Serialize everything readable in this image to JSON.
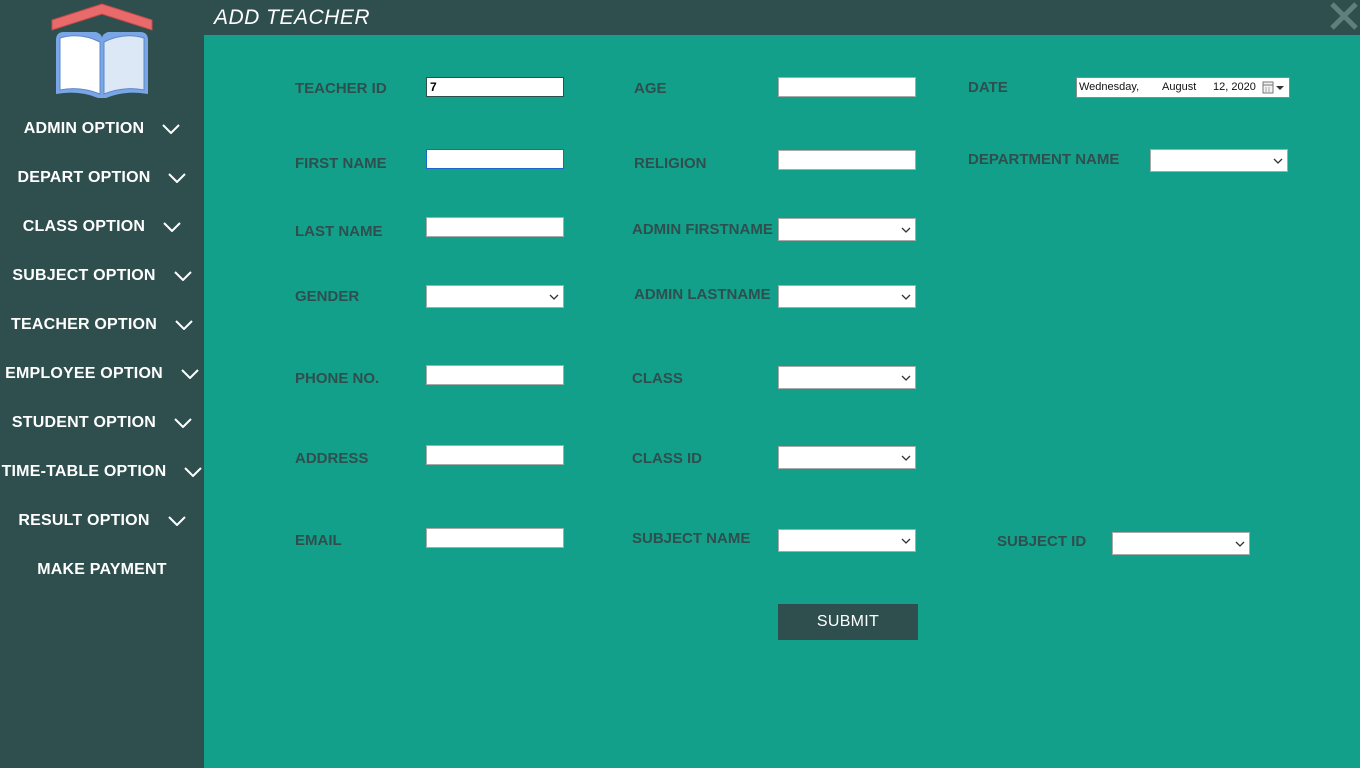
{
  "window": {
    "title": "ADD TEACHER"
  },
  "sidebar": {
    "items": [
      {
        "label": "ADMIN OPTION"
      },
      {
        "label": "DEPART OPTION"
      },
      {
        "label": "CLASS OPTION"
      },
      {
        "label": "SUBJECT OPTION"
      },
      {
        "label": "TEACHER OPTION"
      },
      {
        "label": "EMPLOYEE OPTION"
      },
      {
        "label": "STUDENT OPTION"
      },
      {
        "label": "TIME-TABLE OPTION"
      },
      {
        "label": "RESULT OPTION"
      },
      {
        "label": "MAKE PAYMENT"
      }
    ]
  },
  "form": {
    "teacher_id": {
      "label": "TEACHER ID",
      "value": "7"
    },
    "first_name": {
      "label": "FIRST NAME",
      "value": ""
    },
    "last_name": {
      "label": "LAST NAME",
      "value": ""
    },
    "gender": {
      "label": "GENDER",
      "value": ""
    },
    "phone": {
      "label": "PHONE NO.",
      "value": ""
    },
    "address": {
      "label": "ADDRESS",
      "value": ""
    },
    "email": {
      "label": "EMAIL",
      "value": ""
    },
    "age": {
      "label": "AGE",
      "value": ""
    },
    "religion": {
      "label": "RELIGION",
      "value": ""
    },
    "admin_firstname": {
      "label": "ADMIN FIRSTNAME",
      "value": ""
    },
    "admin_lastname": {
      "label": "ADMIN LASTNAME",
      "value": ""
    },
    "class": {
      "label": "CLASS",
      "value": ""
    },
    "class_id": {
      "label": "CLASS ID",
      "value": ""
    },
    "subject_name": {
      "label": "SUBJECT NAME",
      "value": ""
    },
    "subject_id": {
      "label": "SUBJECT ID",
      "value": ""
    },
    "date": {
      "label": "DATE",
      "weekday": "Wednesday,",
      "month": "August",
      "day_year": "12, 2020"
    },
    "department_name": {
      "label": "DEPARTMENT NAME",
      "value": ""
    },
    "submit_label": "SUBMIT"
  },
  "colors": {
    "sidebar": "#2f4f4f",
    "content": "#12a08a",
    "label_text": "#2f4f4f",
    "button": "#2f4f4f"
  },
  "icons": {
    "logo": "open-book-with-roof-icon",
    "nav_expand": "chevron-down-icon",
    "close": "close-icon",
    "calendar": "calendar-icon"
  }
}
